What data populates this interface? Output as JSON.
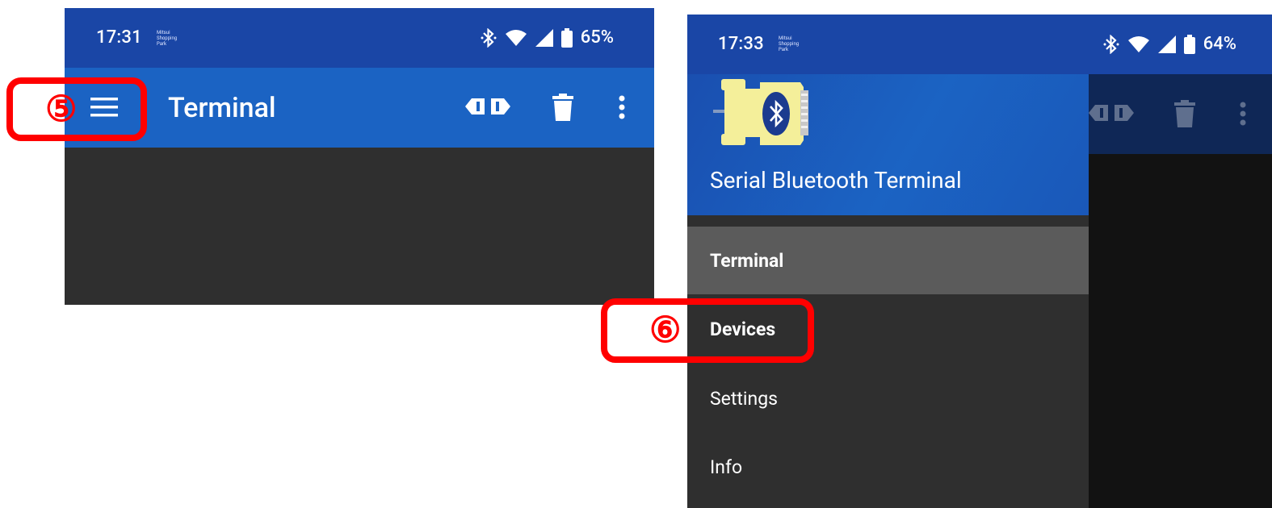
{
  "left_screen": {
    "status_bar": {
      "time": "17:31",
      "mini_text": [
        "Mitsui",
        "Shopping",
        "Park"
      ],
      "battery": "65%"
    },
    "app_bar": {
      "title": "Terminal"
    },
    "annotation": {
      "label": "⑤"
    }
  },
  "right_screen": {
    "status_bar": {
      "time": "17:33",
      "mini_text": [
        "Mitsui",
        "Shopping",
        "Park"
      ],
      "battery": "64%"
    },
    "drawer": {
      "app_name": "Serial Bluetooth Terminal",
      "items": [
        {
          "label": "Terminal",
          "selected": true
        },
        {
          "label": "Devices",
          "selected": false
        },
        {
          "label": "Settings",
          "selected": false
        },
        {
          "label": "Info",
          "selected": false
        }
      ]
    },
    "annotation": {
      "label": "⑥"
    }
  },
  "colors": {
    "status_bar": "#1a46a6",
    "app_bar": "#1b63c3",
    "content_bg": "#2f2f2f",
    "selected_item": "#5b5b5b",
    "annotation": "#ff0000"
  },
  "icons": [
    "menu-icon",
    "connect-icon",
    "trash-icon",
    "more-vert-icon",
    "bluetooth-icon",
    "wifi-icon",
    "signal-icon",
    "battery-icon",
    "app-logo-icon"
  ]
}
